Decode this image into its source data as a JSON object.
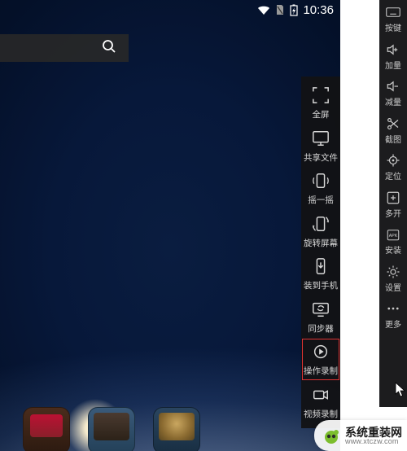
{
  "status_bar": {
    "time": "10:36"
  },
  "search": {
    "placeholder": ""
  },
  "inner_toolbar": [
    {
      "id": "fullscreen",
      "label": "全屏",
      "icon": "fullscreen",
      "highlight": false
    },
    {
      "id": "share-files",
      "label": "共享文件",
      "icon": "monitor-share",
      "highlight": false
    },
    {
      "id": "shake",
      "label": "摇一摇",
      "icon": "shake",
      "highlight": false
    },
    {
      "id": "rotate",
      "label": "旋转屏幕",
      "icon": "rotate",
      "highlight": false
    },
    {
      "id": "install",
      "label": "装到手机",
      "icon": "to-phone",
      "highlight": false
    },
    {
      "id": "syncer",
      "label": "同步器",
      "icon": "sync-monitor",
      "highlight": false
    },
    {
      "id": "op-record",
      "label": "操作录制",
      "icon": "op-record",
      "highlight": true
    },
    {
      "id": "vid-record",
      "label": "视频录制",
      "icon": "camcorder",
      "highlight": false
    }
  ],
  "outer_sidebar": [
    {
      "id": "keys",
      "label": "按键",
      "icon": "keyboard"
    },
    {
      "id": "vol-up",
      "label": "加量",
      "icon": "vol-up"
    },
    {
      "id": "vol-down",
      "label": "减量",
      "icon": "vol-down"
    },
    {
      "id": "screenshot",
      "label": "截图",
      "icon": "scissors"
    },
    {
      "id": "locate",
      "label": "定位",
      "icon": "locate"
    },
    {
      "id": "multi-open",
      "label": "多开",
      "icon": "plus-box"
    },
    {
      "id": "apk-install",
      "label": "安装",
      "icon": "apk"
    },
    {
      "id": "settings",
      "label": "设置",
      "icon": "gear"
    },
    {
      "id": "more",
      "label": "更多",
      "icon": "dots"
    }
  ],
  "dock": [
    {
      "id": "app1"
    },
    {
      "id": "app2"
    },
    {
      "id": "app3"
    }
  ],
  "watermark": {
    "title": "系统重装网",
    "url": "www.xtczw.com"
  }
}
